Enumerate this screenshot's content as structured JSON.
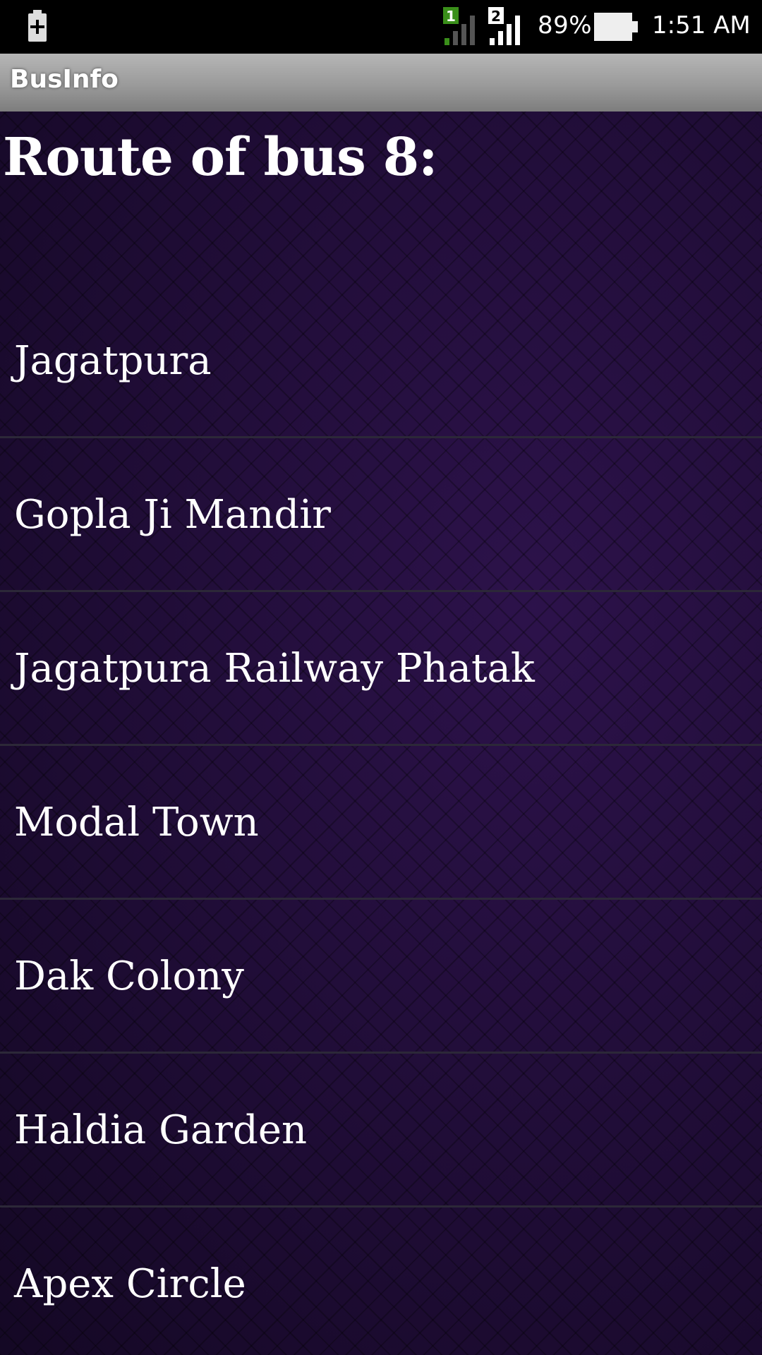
{
  "status_bar": {
    "battery_percent": "89%",
    "time": "1:51 AM",
    "sim1_label": "1",
    "sim2_label": "2",
    "icons": [
      "usb-plus-icon",
      "signal-sim1-icon",
      "signal-sim2-icon",
      "battery-icon"
    ]
  },
  "app": {
    "title": "BusInfo"
  },
  "main": {
    "heading": "Route of bus 8:",
    "stops": [
      {
        "label": "Jagatpura"
      },
      {
        "label": "Gopla Ji Mandir"
      },
      {
        "label": "Jagatpura Railway Phatak"
      },
      {
        "label": "Modal Town"
      },
      {
        "label": "Dak Colony"
      },
      {
        "label": "Haldia Garden"
      },
      {
        "label": "Apex Circle"
      }
    ]
  },
  "colors": {
    "background": "#1f0c38",
    "title_bar": "#9a9a9a",
    "sim1_badge": "#3a8f1a",
    "divider": "#2c2838"
  }
}
